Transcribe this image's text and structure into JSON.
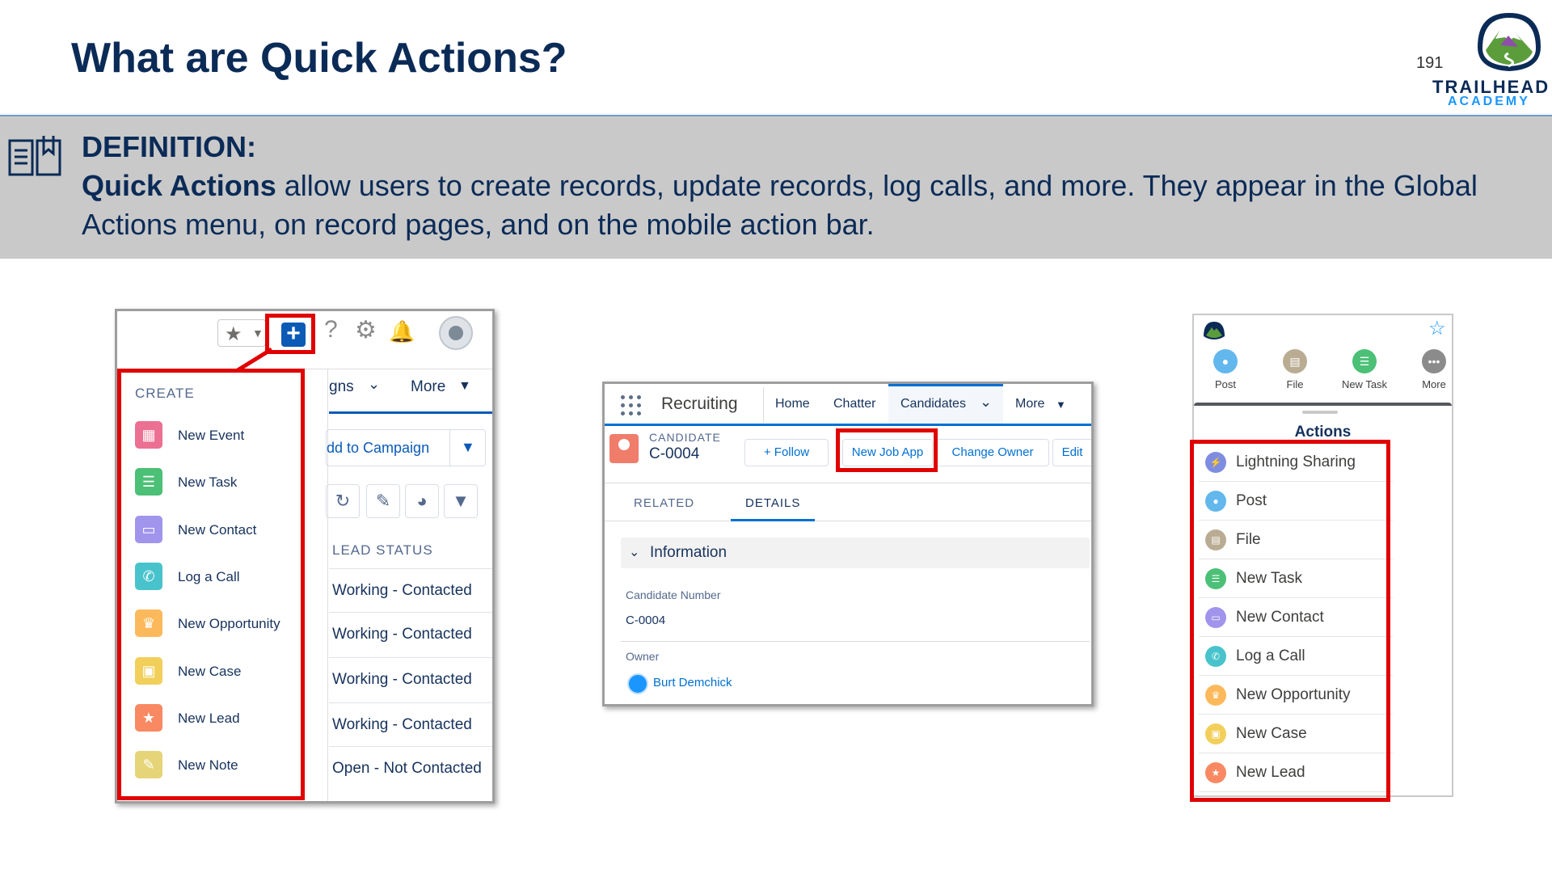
{
  "header": {
    "title": "What are Quick Actions?",
    "page_number": "191",
    "logo_line1": "TRAILHEAD",
    "logo_line2": "ACADEMY"
  },
  "definition": {
    "heading": "DEFINITION:",
    "term": "Quick Actions",
    "text": " allow users to create records, update records, log calls, and more. They appear in the Global Actions menu, on record pages, and on the mobile action bar."
  },
  "left_panel": {
    "create_heading": "CREATE",
    "create_items": [
      {
        "label": "New Event",
        "icon": "calendar-icon",
        "color": "#eb7092"
      },
      {
        "label": "New Task",
        "icon": "task-icon",
        "color": "#4bc076"
      },
      {
        "label": "New Contact",
        "icon": "contact-icon",
        "color": "#a094ed"
      },
      {
        "label": "Log a Call",
        "icon": "phone-icon",
        "color": "#48c3cc"
      },
      {
        "label": "New Opportunity",
        "icon": "crown-icon",
        "color": "#fcb95b"
      },
      {
        "label": "New Case",
        "icon": "briefcase-icon",
        "color": "#f2cf5b"
      },
      {
        "label": "New Lead",
        "icon": "lead-star-icon",
        "color": "#f88962"
      },
      {
        "label": "New Note",
        "icon": "note-icon",
        "color": "#e6d478"
      }
    ],
    "tab_partial": "gns",
    "tab_more": "More",
    "campaign_button": "dd to Campaign",
    "lead_status_header": "LEAD STATUS",
    "lead_statuses": [
      "Working - Contacted",
      "Working - Contacted",
      "Working - Contacted",
      "Working - Contacted",
      "Open - Not Contacted"
    ]
  },
  "middle_panel": {
    "app_name": "Recruiting",
    "nav": [
      "Home",
      "Chatter",
      "Candidates",
      "More"
    ],
    "record_type": "CANDIDATE",
    "record_name": "C-0004",
    "buttons": {
      "follow": "Follow",
      "new_job_app": "New Job App",
      "change_owner": "Change Owner",
      "edit": "Edit"
    },
    "tabs": {
      "related": "RELATED",
      "details": "DETAILS"
    },
    "section": "Information",
    "fields": [
      {
        "label": "Candidate Number",
        "value": "C-0004"
      },
      {
        "label": "Owner",
        "value": "Burt Demchick"
      }
    ]
  },
  "right_panel": {
    "action_bar": [
      {
        "label": "Post",
        "icon": "post-icon",
        "color": "#62b7ed"
      },
      {
        "label": "File",
        "icon": "file-icon",
        "color": "#baac93"
      },
      {
        "label": "New Task",
        "icon": "task-icon",
        "color": "#4bc076"
      },
      {
        "label": "More",
        "icon": "more-icon",
        "color": "#8b8b8b"
      }
    ],
    "actions_heading": "Actions",
    "actions": [
      {
        "label": "Lightning Sharing",
        "icon": "lightning-icon",
        "color": "#7f8de1"
      },
      {
        "label": "Post",
        "icon": "post-icon",
        "color": "#62b7ed"
      },
      {
        "label": "File",
        "icon": "file-icon",
        "color": "#baac93"
      },
      {
        "label": "New Task",
        "icon": "task-icon",
        "color": "#4bc076"
      },
      {
        "label": "New Contact",
        "icon": "contact-icon",
        "color": "#a094ed"
      },
      {
        "label": "Log a Call",
        "icon": "phone-icon",
        "color": "#48c3cc"
      },
      {
        "label": "New Opportunity",
        "icon": "crown-icon",
        "color": "#fcb95b"
      },
      {
        "label": "New Case",
        "icon": "briefcase-icon",
        "color": "#f2cf5b"
      },
      {
        "label": "New Lead",
        "icon": "lead-star-icon",
        "color": "#f88962"
      }
    ]
  },
  "colors": {
    "highlight": "#e00000",
    "brand_blue": "#0a5ab6",
    "title_navy": "#0b2b57"
  }
}
